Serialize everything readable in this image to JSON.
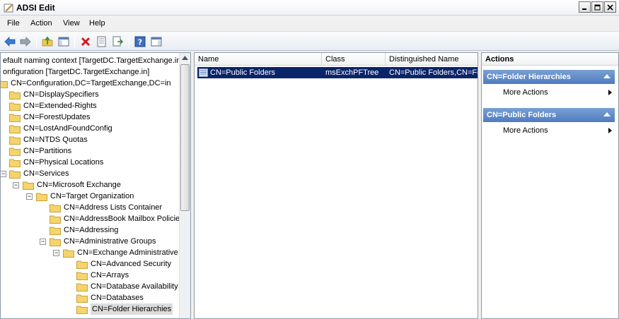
{
  "window": {
    "title": "ADSI Edit"
  },
  "menu": {
    "items": [
      "File",
      "Action",
      "View",
      "Help"
    ]
  },
  "tree": {
    "items": [
      {
        "label": "efault naming context [TargetDC.TargetExchange.in"
      },
      {
        "label": "onfiguration [TargetDC.TargetExchange.in]"
      },
      {
        "label": "CN=Configuration,DC=TargetExchange,DC=in"
      },
      {
        "label": "CN=DisplaySpecifiers"
      },
      {
        "label": "CN=Extended-Rights"
      },
      {
        "label": "CN=ForestUpdates"
      },
      {
        "label": "CN=LostAndFoundConfig"
      },
      {
        "label": "CN=NTDS Quotas"
      },
      {
        "label": "CN=Partitions"
      },
      {
        "label": "CN=Physical Locations"
      },
      {
        "label": "CN=Services"
      },
      {
        "label": "CN=Microsoft Exchange"
      },
      {
        "label": "CN=Target Organization"
      },
      {
        "label": "CN=Address Lists Container"
      },
      {
        "label": "CN=AddressBook Mailbox Policies"
      },
      {
        "label": "CN=Addressing"
      },
      {
        "label": "CN=Administrative Groups"
      },
      {
        "label": "CN=Exchange Administrative"
      },
      {
        "label": "CN=Advanced Security"
      },
      {
        "label": "CN=Arrays"
      },
      {
        "label": "CN=Database Availability"
      },
      {
        "label": "CN=Databases"
      },
      {
        "label": "CN=Folder Hierarchies"
      }
    ]
  },
  "list": {
    "columns": [
      "Name",
      "Class",
      "Distinguished Name"
    ],
    "rows": [
      {
        "name": "CN=Public Folders",
        "class": "msExchPFTree",
        "dn": "CN=Public Folders,CN=Fo"
      }
    ]
  },
  "actions": {
    "header": "Actions",
    "sections": [
      {
        "title": "CN=Folder Hierarchies",
        "item": "More Actions"
      },
      {
        "title": "CN=Public Folders",
        "item": "More Actions"
      }
    ]
  },
  "colors": {
    "selection": "#0a246a",
    "section": "#5b86c6",
    "folder": "#f5d46b"
  }
}
